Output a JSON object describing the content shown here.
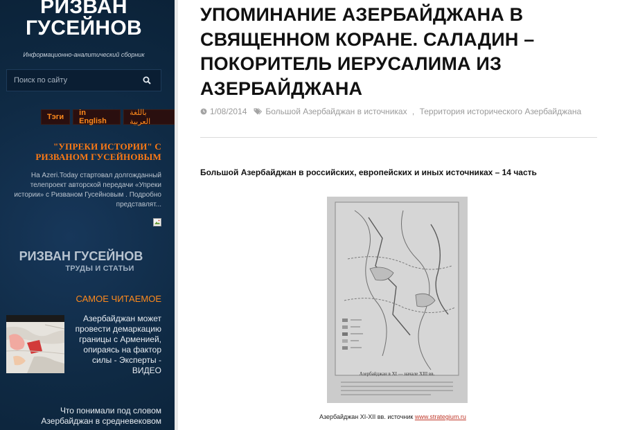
{
  "sidebar": {
    "site_title_line1": "РИЗВАН",
    "site_title_line2": "ГУСЕЙНОВ",
    "site_description": "Информационно-аналитический сборник",
    "search_placeholder": "Поиск по сайту",
    "lang_buttons": [
      "Тэги",
      "in English",
      "باللغة العربية"
    ],
    "promo_title": "\"УПРЕКИ ИСТОРИИ\" С РИЗВАНОМ ГУСЕЙНОВЫМ",
    "promo_text": "На Azeri.Today  стартовал долгожданный телепроект авторской передачи «Упреки истории» с Ризваном Гусейновым . Подробно представлят...",
    "author_title": "РИЗВАН ГУСЕЙНОВ",
    "author_subtitle": "ТРУДЫ И СТАТЬИ",
    "most_read_label": "САМОЕ ЧИТАЕМОЕ",
    "posts": [
      "Азербайджан может провести демаркацию границы с Арменией, опираясь на фактор силы - Эксперты - ВИДЕО",
      "Что понимали под словом Азербайджан в средневековом"
    ]
  },
  "article": {
    "title": "УПОМИНАНИЕ АЗЕРБАЙДЖАНА В СВЯЩЕННОМ КОРАНЕ. САЛАДИН – ПОКОРИТЕЛЬ ИЕРУСАЛИМА ИЗ АЗЕРБАЙДЖАНА",
    "date": "1/08/2014",
    "categories": [
      "Большой Азербайджан в источниках",
      "Территория исторического Азербайджана"
    ],
    "category_separator": " , ",
    "subheading": "Большой Азербайджан в российских, европейских и иных источниках – 14 часть",
    "map_heading": "Азербайджан в XI — начале XIII вв.",
    "caption_text": "Азербайджан XI-XII вв. источник",
    "caption_link": "www.strategium.ru"
  },
  "icons": {
    "search": "search-icon",
    "clock": "clock-icon",
    "tags": "tags-icon",
    "broken_image": "broken-image-icon"
  },
  "colors": {
    "sidebar_bg": "#0f2a44",
    "accent_orange": "#ff7a14",
    "link_red": "#c0392b"
  }
}
